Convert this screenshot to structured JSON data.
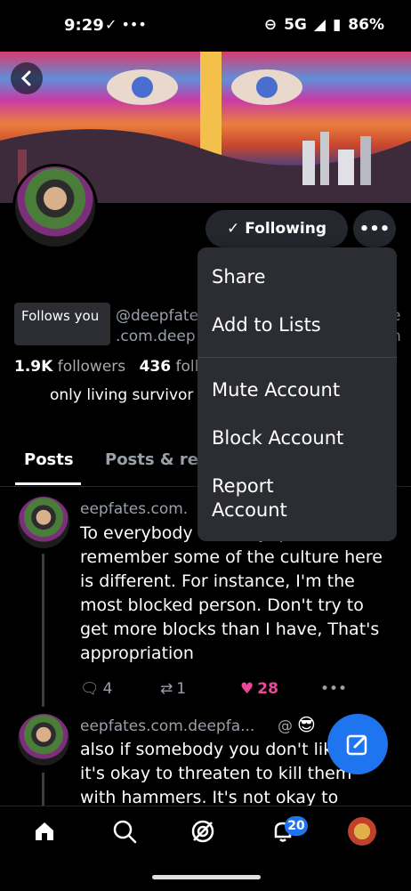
{
  "status_bar": {
    "time": "9:29",
    "network": "5G",
    "battery": "86%"
  },
  "profile": {
    "follow_button": "Following",
    "follows_you": "Follows you",
    "handle_line1": "@deepfate",
    "handle_line2": ".com.deep",
    "handle_right1": "e",
    "handle_right2": "n",
    "followers_count": "1.9K",
    "followers_label": "followers",
    "following_count": "436",
    "following_label": "foll",
    "bio": "only living survivor"
  },
  "tabs": {
    "active": "Posts",
    "other": "Posts & rep"
  },
  "posts": [
    {
      "name": "eepfates.com.",
      "text": "To everybody                              bluesky, please remember some of the culture here is different. For instance, I'm the most blocked person. Don't try to get more blocks than I have, That's appropriation",
      "replies": "4",
      "reposts": "1",
      "likes": "28"
    },
    {
      "name": "eepfates.com.deepfa...",
      "at": "@",
      "text": "also if somebody you don't lik here, it's okay to threaten to kill them with hammers. It's not okay to"
    }
  ],
  "menu": {
    "items": [
      "Share",
      "Add to Lists",
      "Mute Account",
      "Block Account",
      "Report Account"
    ]
  },
  "nav": {
    "notifications_badge": "20"
  },
  "colors": {
    "accent": "#1f75f0",
    "like": "#ec4899"
  }
}
